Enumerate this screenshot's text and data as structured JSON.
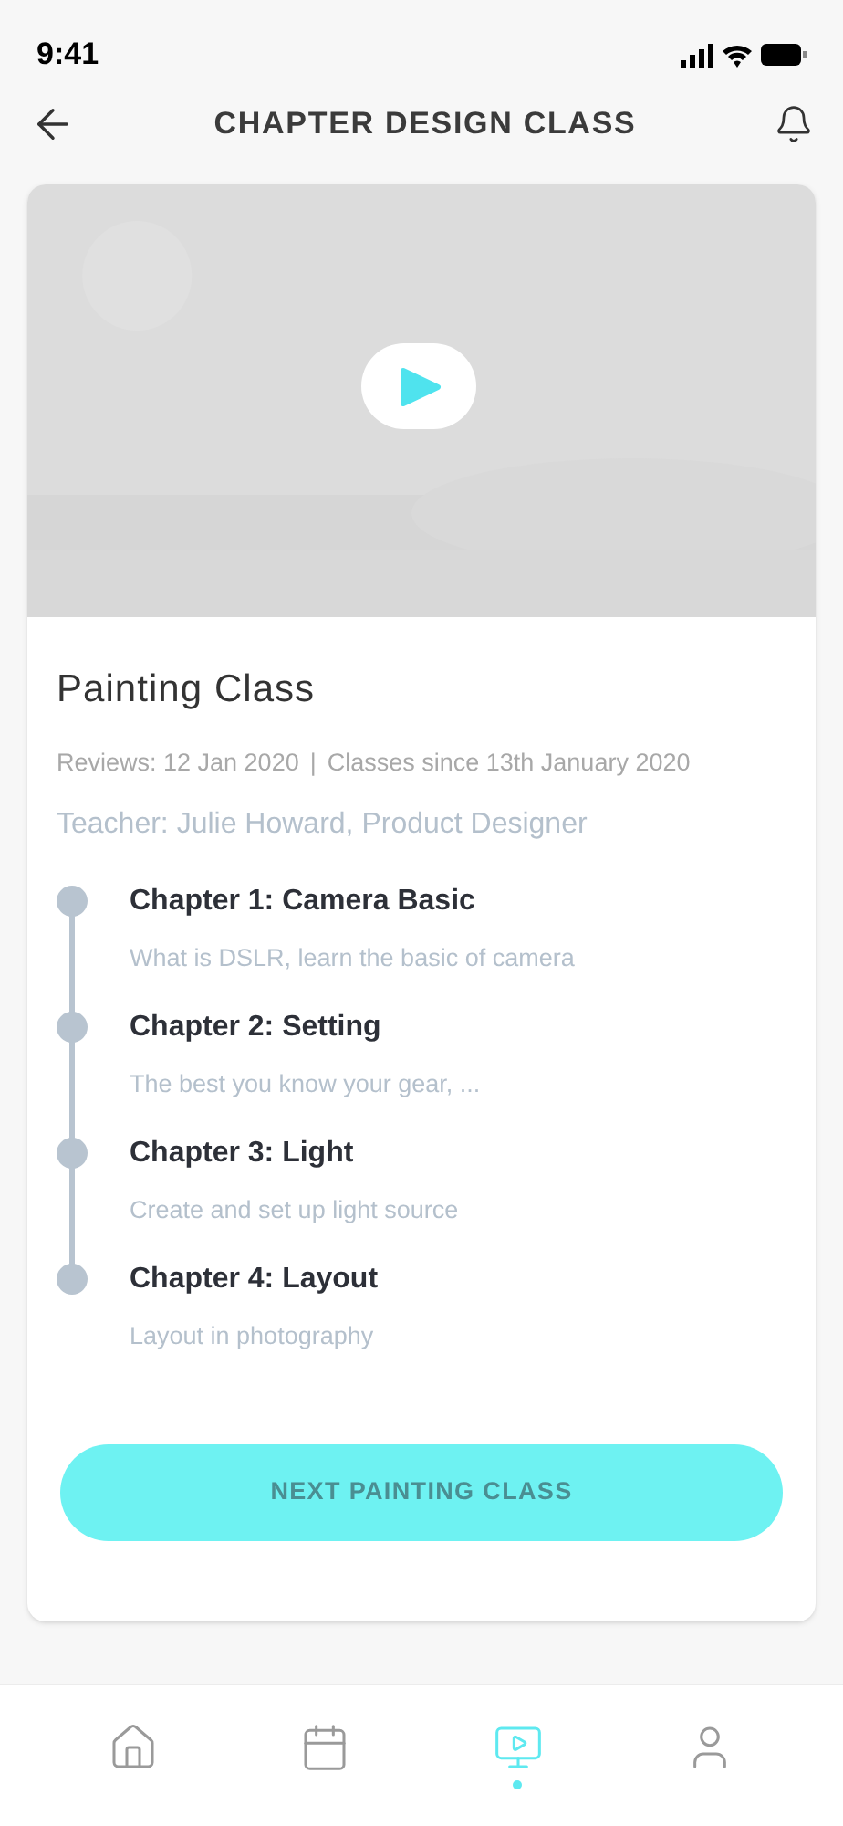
{
  "status_bar": {
    "time": "9:41"
  },
  "header": {
    "title": "CHAPTER DESIGN CLASS"
  },
  "course": {
    "title": "Painting Class",
    "meta": [
      "Reviews: 12 Jan 2020",
      "|",
      "Classes since 13th January 2020"
    ],
    "teacher": "Teacher: Julie Howard, Product Designer",
    "chapters": [
      {
        "title": "Chapter 1: Camera Basic",
        "subtitle": "What is DSLR, learn the basic of camera"
      },
      {
        "title": "Chapter 2: Setting",
        "subtitle": "The best you know your gear, ..."
      },
      {
        "title": "Chapter 3: Light",
        "subtitle": "Create and set up light source"
      },
      {
        "title": "Chapter 4: Layout",
        "subtitle": "Layout in photography"
      }
    ],
    "button": "NEXT PAINTING CLASS"
  },
  "nav": [
    {
      "kind": "home",
      "selected": false
    },
    {
      "kind": "calendar",
      "selected": false
    },
    {
      "kind": "video",
      "selected": true
    },
    {
      "kind": "profile",
      "selected": false
    }
  ]
}
